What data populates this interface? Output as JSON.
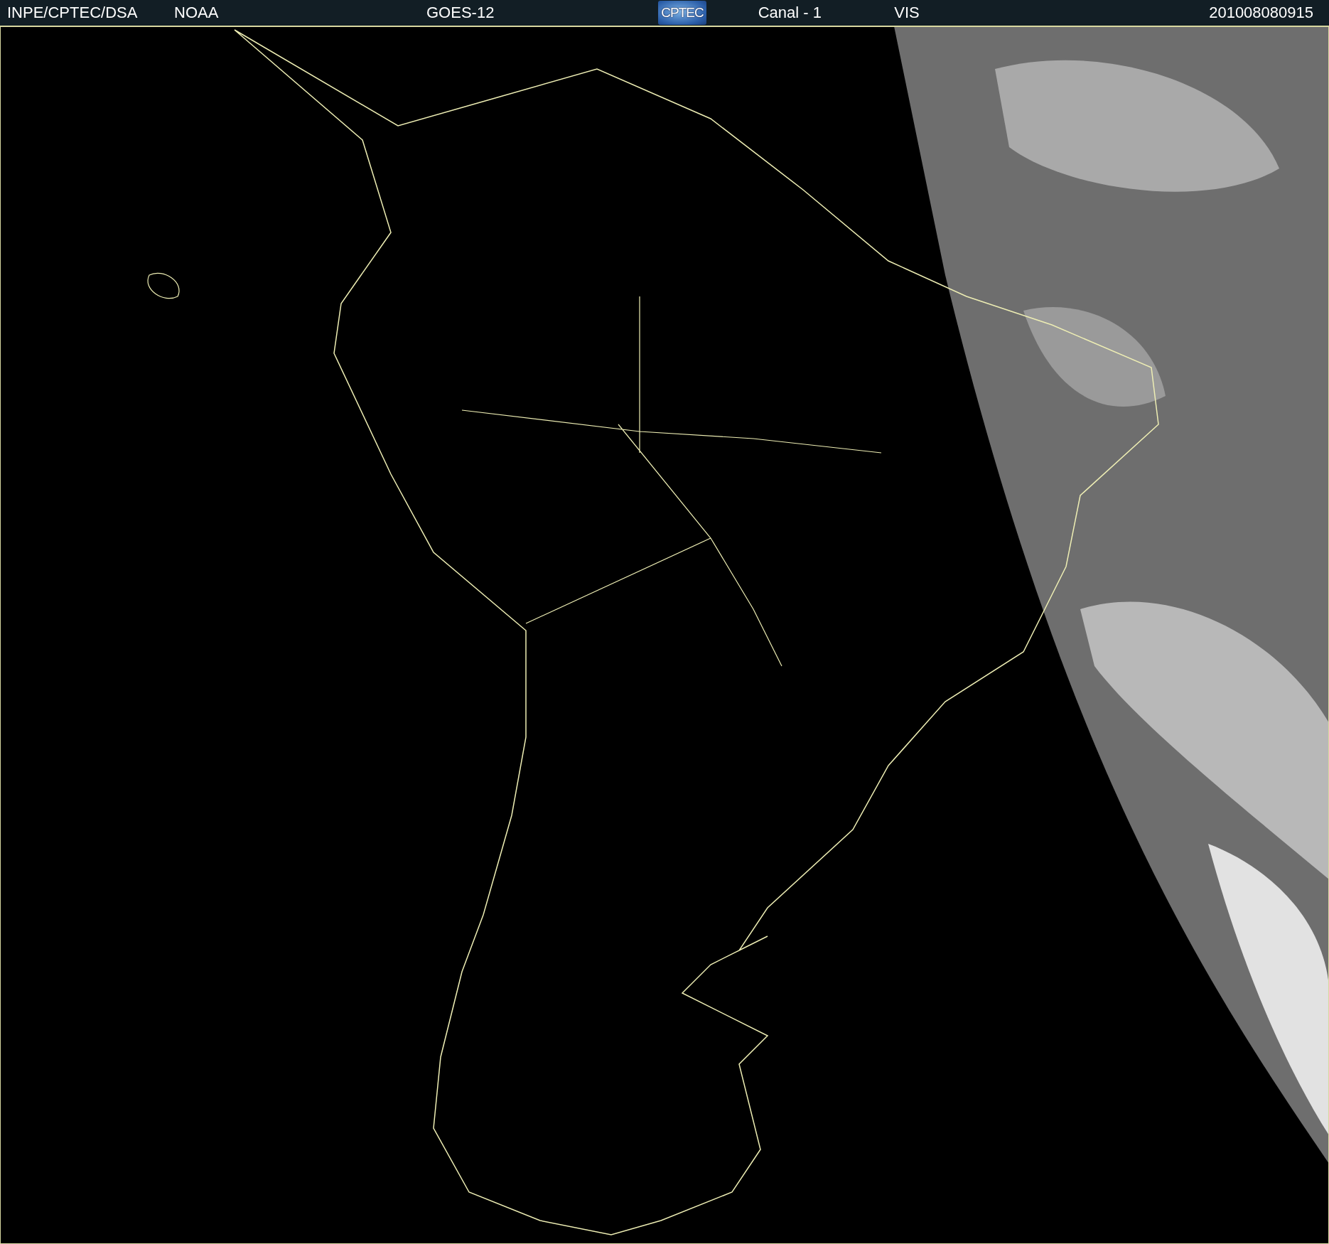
{
  "header": {
    "source": "INPE/CPTEC/DSA",
    "agency": "NOAA",
    "satellite": "GOES-12",
    "logo": "CPTEC",
    "channel": "Canal - 1",
    "band": "VIS",
    "timestamp": "201008080915"
  }
}
